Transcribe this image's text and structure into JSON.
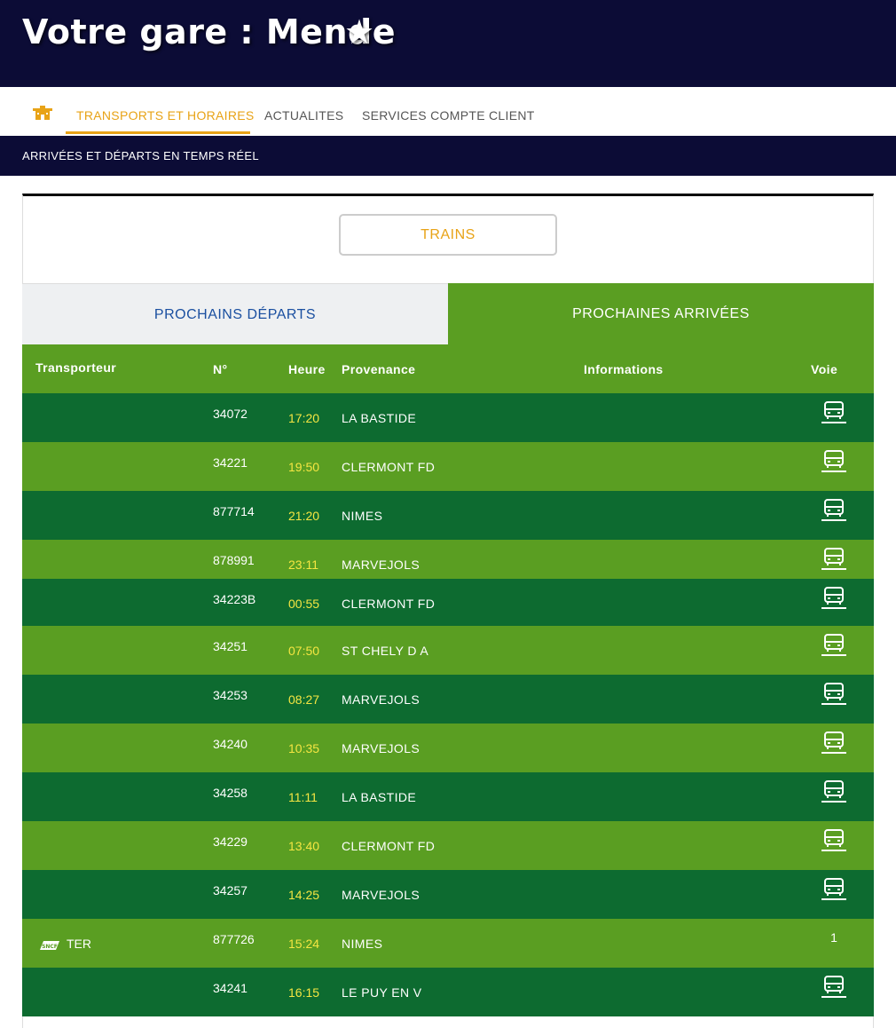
{
  "header": {
    "title": "Votre gare : Mende"
  },
  "nav": {
    "items": [
      {
        "label": "TRANSPORTS ET HORAIRES",
        "active": true
      },
      {
        "label": "ACTUALITES",
        "active": false
      },
      {
        "label": "SERVICES COMPTE CLIENT",
        "active": false
      }
    ]
  },
  "subnav": {
    "label": "ARRIVÉES ET DÉPARTS EN TEMPS RÉEL"
  },
  "mode_button": {
    "label": "TRAINS"
  },
  "tabs": {
    "departures": "PROCHAINS DÉPARTS",
    "arrivals": "PROCHAINES ARRIVÉES",
    "active": "arrivals"
  },
  "table": {
    "headers": {
      "carrier": "Transporteur",
      "number": "N°",
      "time": "Heure",
      "origin": "Provenance",
      "info": "Informations",
      "track": "Voie"
    },
    "rows": [
      {
        "carrier": "",
        "number": "34072",
        "time": "17:20",
        "origin": "LA BASTIDE",
        "info": "",
        "track": "bus-icon"
      },
      {
        "carrier": "",
        "number": "34221",
        "time": "19:50",
        "origin": "CLERMONT FD",
        "info": "",
        "track": "bus-icon"
      },
      {
        "carrier": "",
        "number": "877714",
        "time": "21:20",
        "origin": "NIMES",
        "info": "",
        "track": "bus-icon"
      },
      {
        "carrier": "",
        "number": "878991",
        "time": "23:11",
        "origin": "MARVEJOLS",
        "info": "",
        "track": "bus-icon"
      },
      {
        "carrier": "",
        "number": "34223B",
        "time": "00:55",
        "origin": "CLERMONT FD",
        "info": "",
        "track": "bus-icon"
      },
      {
        "carrier": "",
        "number": "34251",
        "time": "07:50",
        "origin": "ST CHELY D A",
        "info": "",
        "track": "bus-icon"
      },
      {
        "carrier": "",
        "number": "34253",
        "time": "08:27",
        "origin": "MARVEJOLS",
        "info": "",
        "track": "bus-icon"
      },
      {
        "carrier": "",
        "number": "34240",
        "time": "10:35",
        "origin": "MARVEJOLS",
        "info": "",
        "track": "bus-icon"
      },
      {
        "carrier": "",
        "number": "34258",
        "time": "11:11",
        "origin": "LA BASTIDE",
        "info": "",
        "track": "bus-icon"
      },
      {
        "carrier": "",
        "number": "34229",
        "time": "13:40",
        "origin": "CLERMONT FD",
        "info": "",
        "track": "bus-icon"
      },
      {
        "carrier": "",
        "number": "34257",
        "time": "14:25",
        "origin": "MARVEJOLS",
        "info": "",
        "track": "bus-icon"
      },
      {
        "carrier": "TER",
        "carrier_logo": "sncf-logo",
        "number": "877726",
        "time": "15:24",
        "origin": "NIMES",
        "info": "",
        "track": "1"
      },
      {
        "carrier": "",
        "number": "34241",
        "time": "16:15",
        "origin": "LE PUY EN V",
        "info": "",
        "track": "bus-icon"
      }
    ]
  },
  "icons": {
    "home": "home-icon",
    "favorite": "star-icon",
    "bus": "bus-icon",
    "sncf": "sncf-logo"
  },
  "colors": {
    "header_bg": "#0c0c36",
    "accent": "#e8a317",
    "row_dark": "#0d6b30",
    "row_light": "#5a9e22",
    "time_text": "#f5e642",
    "tab_inactive_text": "#1a4fa0"
  }
}
